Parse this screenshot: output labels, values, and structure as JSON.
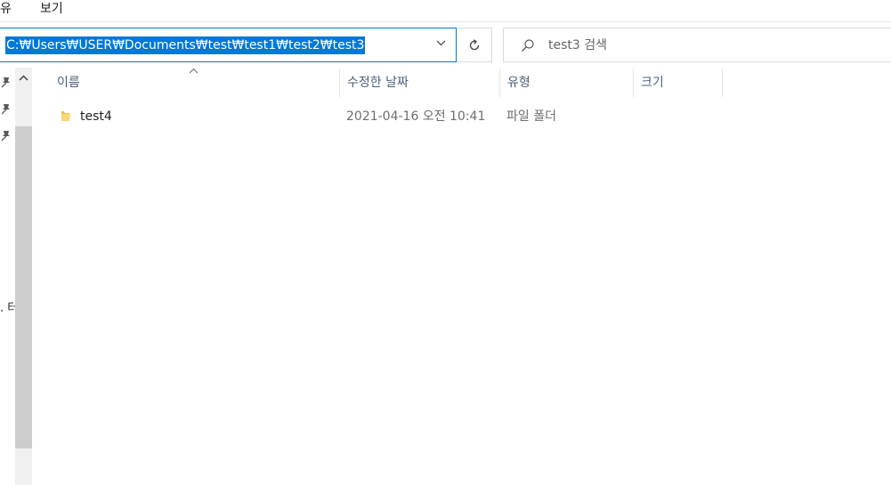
{
  "menubar": {
    "items": [
      "유",
      "보기"
    ]
  },
  "address_bar": {
    "path": "C:₩Users₩USER₩Documents₩test₩test1₩test2₩test3"
  },
  "search": {
    "placeholder": "test3 검색"
  },
  "nav_pane": {
    "partial_label": ". 터"
  },
  "columns": {
    "name": "이름",
    "modified": "수정한 날짜",
    "type": "유형",
    "size": "크기"
  },
  "files": [
    {
      "name": "test4",
      "modified": "2021-04-16 오전 10:41",
      "type": "파일 폴더",
      "size": ""
    }
  ]
}
